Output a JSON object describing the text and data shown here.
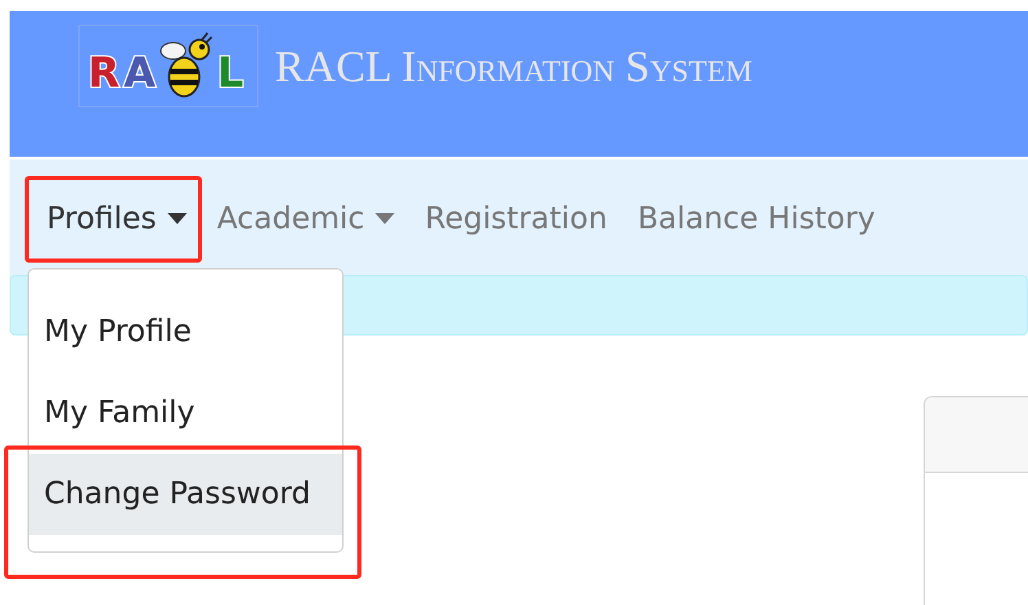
{
  "header": {
    "logo": {
      "letters": [
        {
          "text": "R",
          "color": "#c8202c"
        },
        {
          "text": "A",
          "color": "#4a58b0"
        },
        {
          "text": "L",
          "color": "#1f8a2c"
        }
      ]
    },
    "title": "RACL Information System"
  },
  "nav": {
    "items": [
      {
        "label": "Profiles",
        "kind": "dropdown",
        "expanded": true,
        "annotated": true,
        "menu": [
          {
            "label": "My Profile",
            "selected": false
          },
          {
            "label": "My Family",
            "selected": false
          },
          {
            "label": "Change Password",
            "selected": true,
            "annotated": true
          }
        ]
      },
      {
        "label": "Academic",
        "kind": "dropdown",
        "expanded": false
      },
      {
        "label": "Registration",
        "kind": "link"
      },
      {
        "label": "Balance History",
        "kind": "link"
      }
    ]
  }
}
